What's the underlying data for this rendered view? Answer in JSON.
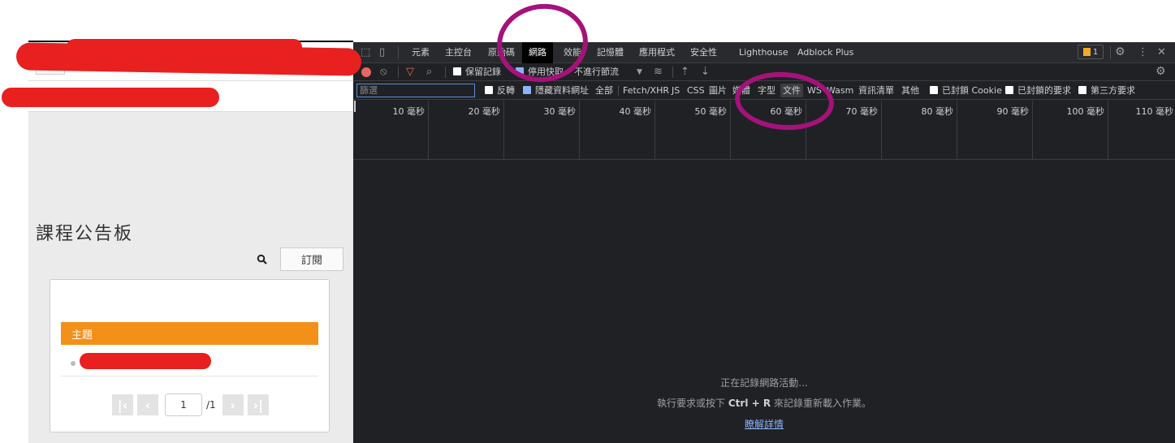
{
  "page": {
    "board_title": "課程公告板",
    "subscribe_label": "訂閱",
    "table_header": "主題",
    "pager": {
      "current": "1",
      "total": "/1"
    },
    "pager_icons": [
      "first-page-icon",
      "prev-page-icon",
      "next-page-icon",
      "last-page-icon"
    ]
  },
  "devtools": {
    "tabs": [
      "元素",
      "主控台",
      "原始碼",
      "網路",
      "效能",
      "記憶體",
      "應用程式",
      "安全性",
      "Lighthouse",
      "Adblock Plus"
    ],
    "active_tab": "網路",
    "issues_count": "1",
    "toolbar": {
      "preserve_log": "保留記錄",
      "disable_cache": "停用快取",
      "throttling": "不進行節流"
    },
    "filter": {
      "placeholder": "篩選",
      "invert": "反轉",
      "hide_data_urls": "隱藏資料網址",
      "types": [
        "全部",
        "Fetch/XHR",
        "JS",
        "CSS",
        "圖片",
        "媒體",
        "字型",
        "文件",
        "WS",
        "Wasm",
        "資訊清單",
        "其他"
      ],
      "selected_type": "文件",
      "blocked_cookies": "已封鎖 Cookie",
      "blocked_requests": "已封鎖的要求",
      "third_party": "第三方要求"
    },
    "timeline_ticks": [
      "10 毫秒",
      "20 毫秒",
      "30 毫秒",
      "40 毫秒",
      "50 毫秒",
      "60 毫秒",
      "70 毫秒",
      "80 毫秒",
      "90 毫秒",
      "100 毫秒",
      "110 毫秒"
    ],
    "empty": {
      "recording": "正在記錄網路活動...",
      "hint_prefix": "執行要求或按下",
      "hint_keys": "Ctrl + R",
      "hint_suffix": "來記錄重新載入作業。",
      "learn_more": "瞭解詳情"
    }
  },
  "colors": {
    "accent_orange": "#f39019",
    "devtools_bg": "#202124",
    "redaction": "#e8201f",
    "annotation": "#a4127a"
  }
}
